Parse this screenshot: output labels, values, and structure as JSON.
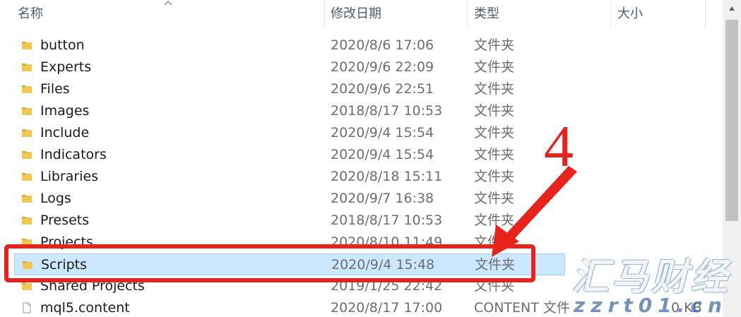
{
  "columns": {
    "name": "名称",
    "date": "修改日期",
    "type": "类型",
    "size": "大小"
  },
  "files": [
    {
      "name": "button",
      "date": "2020/8/6 17:06",
      "type": "文件夹",
      "size": "",
      "icon": "folder-icon",
      "selected": false
    },
    {
      "name": "Experts",
      "date": "2020/9/6 22:09",
      "type": "文件夹",
      "size": "",
      "icon": "folder-icon",
      "selected": false
    },
    {
      "name": "Files",
      "date": "2020/9/6 22:51",
      "type": "文件夹",
      "size": "",
      "icon": "folder-icon",
      "selected": false
    },
    {
      "name": "Images",
      "date": "2018/8/17 10:53",
      "type": "文件夹",
      "size": "",
      "icon": "folder-icon",
      "selected": false
    },
    {
      "name": "Include",
      "date": "2020/9/4 15:54",
      "type": "文件夹",
      "size": "",
      "icon": "folder-icon",
      "selected": false
    },
    {
      "name": "Indicators",
      "date": "2020/9/4 15:54",
      "type": "文件夹",
      "size": "",
      "icon": "folder-icon",
      "selected": false
    },
    {
      "name": "Libraries",
      "date": "2020/8/18 15:11",
      "type": "文件夹",
      "size": "",
      "icon": "folder-icon",
      "selected": false
    },
    {
      "name": "Logs",
      "date": "2020/9/7 16:38",
      "type": "文件夹",
      "size": "",
      "icon": "folder-icon",
      "selected": false
    },
    {
      "name": "Presets",
      "date": "2018/8/17 10:53",
      "type": "文件夹",
      "size": "",
      "icon": "folder-icon",
      "selected": false
    },
    {
      "name": "Projects",
      "date": "2020/8/10 11:49",
      "type": "文件夹",
      "size": "",
      "icon": "folder-icon",
      "selected": false
    },
    {
      "name": "Scripts",
      "date": "2020/9/4 15:48",
      "type": "文件夹",
      "size": "",
      "icon": "folder-icon",
      "selected": true
    },
    {
      "name": "Shared Projects",
      "date": "2019/1/25 22:42",
      "type": "文件夹",
      "size": "",
      "icon": "folder-icon",
      "selected": false
    },
    {
      "name": "mql5.content",
      "date": "2020/8/17 17:00",
      "type": "CONTENT 文件",
      "size": "0 KB",
      "icon": "file-icon",
      "selected": false
    }
  ],
  "annotation": {
    "step_number": "4",
    "color": "#e8231b"
  },
  "watermark": {
    "title": "汇马财经",
    "url": "zzrt01.cn"
  },
  "colors": {
    "selection_bg": "#cce8ff",
    "selection_border": "#99d1ff",
    "folder": "#f2c94c",
    "header_text": "#4d5b6b"
  }
}
